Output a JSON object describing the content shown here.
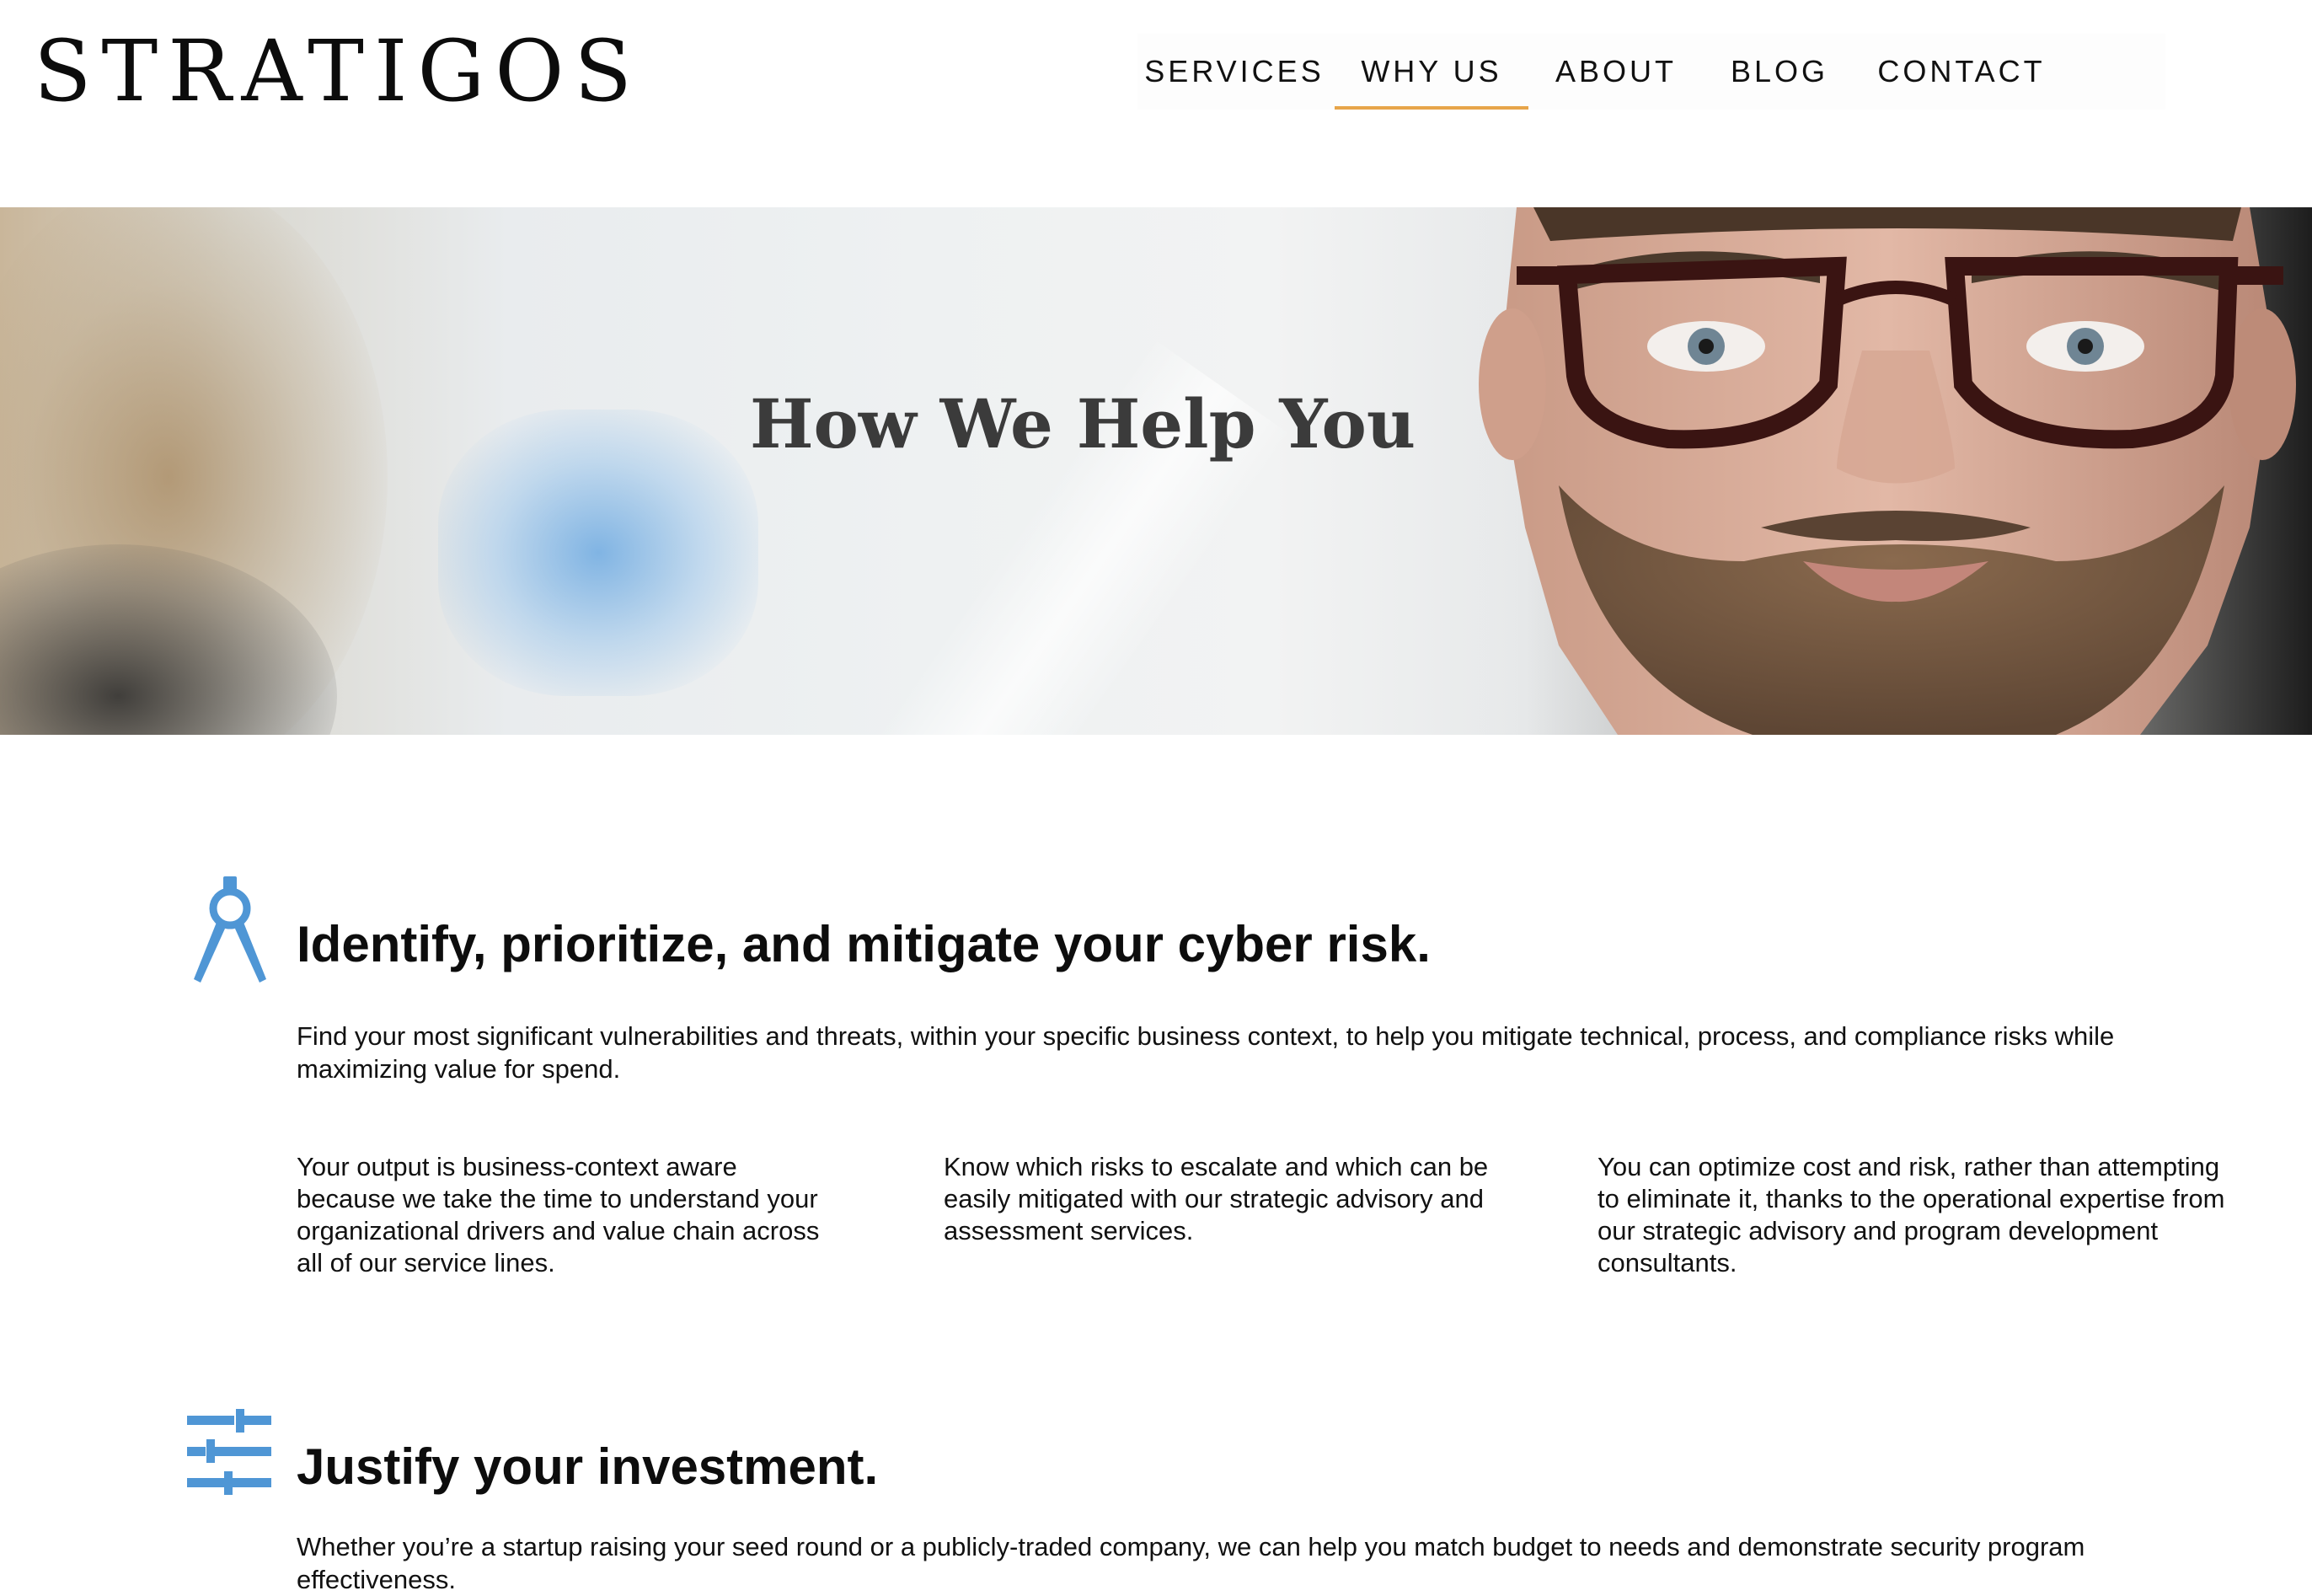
{
  "header": {
    "logo_text": "STRATIGOS",
    "nav": [
      {
        "label": "SERVICES",
        "active": false
      },
      {
        "label": "WHY US",
        "active": true
      },
      {
        "label": "ABOUT",
        "active": false
      },
      {
        "label": "BLOG",
        "active": false
      },
      {
        "label": "CONTACT",
        "active": false
      }
    ],
    "active_underline_color": "#e7a54a"
  },
  "hero": {
    "title": "How We Help You"
  },
  "sections": [
    {
      "icon": "compass-icon",
      "icon_color": "#4f96d5",
      "heading": "Identify, prioritize, and mitigate your cyber risk.",
      "lead": "Find your most significant vulnerabilities and threats, within your specific business context, to help you mitigate technical, process, and compliance risks while maximizing value for spend.",
      "columns": [
        "Your output is business-context aware because we take the time to understand your organizational drivers and value chain across all of our service lines.",
        "Know which risks to escalate and which can be easily mitigated with our strategic advisory and assessment services.",
        "You can optimize cost and risk, rather than attempting to eliminate it, thanks to the operational expertise from our strategic advisory and program development consultants."
      ]
    },
    {
      "icon": "sliders-icon",
      "icon_color": "#4f96d5",
      "heading": "Justify your investment.",
      "lead": "Whether you’re a startup raising your seed round or a publicly-traded company, we can help you match budget to needs and demonstrate security program effectiveness."
    }
  ]
}
